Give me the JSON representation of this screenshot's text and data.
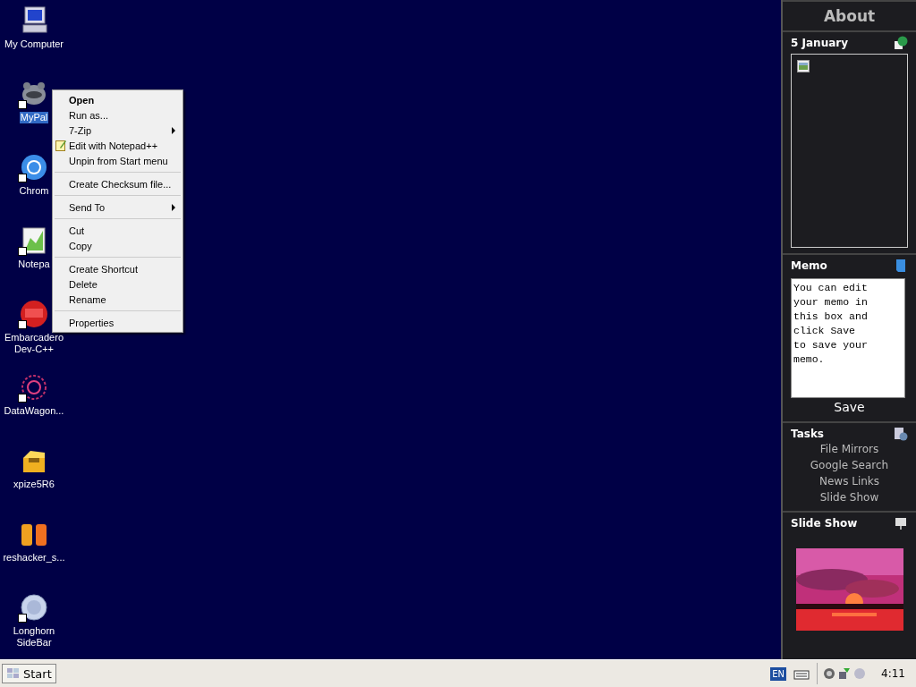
{
  "desktop": {
    "icons": [
      {
        "label": "My Computer",
        "kind": "computer",
        "shortcut": false,
        "selected": false
      },
      {
        "label": "MyPal",
        "kind": "critter",
        "shortcut": true,
        "selected": true
      },
      {
        "label": "Chrom",
        "kind": "ring",
        "shortcut": true,
        "selected": false
      },
      {
        "label": "Notepa",
        "kind": "notepad",
        "shortcut": true,
        "selected": false
      },
      {
        "label": "Embarcadero\nDev-C++",
        "kind": "badge",
        "shortcut": true,
        "selected": false
      },
      {
        "label": "DataWagon...",
        "kind": "star",
        "shortcut": true,
        "selected": false
      },
      {
        "label": "xpize5R6",
        "kind": "box",
        "shortcut": false,
        "selected": false
      },
      {
        "label": "reshacker_s...",
        "kind": "letters",
        "shortcut": false,
        "selected": false
      },
      {
        "label": "Longhorn\nSideBar",
        "kind": "disc",
        "shortcut": true,
        "selected": false
      }
    ]
  },
  "context_menu": {
    "items": [
      {
        "kind": "item",
        "label": "Open",
        "default": true,
        "submenu": false,
        "icon": false
      },
      {
        "kind": "item",
        "label": "Run as...",
        "default": false,
        "submenu": false,
        "icon": false
      },
      {
        "kind": "item",
        "label": "7-Zip",
        "default": false,
        "submenu": true,
        "icon": false
      },
      {
        "kind": "item",
        "label": "Edit with Notepad++",
        "default": false,
        "submenu": false,
        "icon": true
      },
      {
        "kind": "item",
        "label": "Unpin from Start menu",
        "default": false,
        "submenu": false,
        "icon": false
      },
      {
        "kind": "separator"
      },
      {
        "kind": "item",
        "label": "Create Checksum file...",
        "default": false,
        "submenu": false,
        "icon": false
      },
      {
        "kind": "separator"
      },
      {
        "kind": "item",
        "label": "Send To",
        "default": false,
        "submenu": true,
        "icon": false
      },
      {
        "kind": "separator"
      },
      {
        "kind": "item",
        "label": "Cut",
        "default": false,
        "submenu": false,
        "icon": false
      },
      {
        "kind": "item",
        "label": "Copy",
        "default": false,
        "submenu": false,
        "icon": false
      },
      {
        "kind": "separator"
      },
      {
        "kind": "item",
        "label": "Create Shortcut",
        "default": false,
        "submenu": false,
        "icon": false
      },
      {
        "kind": "item",
        "label": "Delete",
        "default": false,
        "submenu": false,
        "icon": false
      },
      {
        "kind": "item",
        "label": "Rename",
        "default": false,
        "submenu": false,
        "icon": false
      },
      {
        "kind": "separator"
      },
      {
        "kind": "item",
        "label": "Properties",
        "default": false,
        "submenu": false,
        "icon": false
      }
    ]
  },
  "sidebar": {
    "title": "About",
    "calendar": {
      "title": "5 January"
    },
    "memo": {
      "title": "Memo",
      "value": "You can edit\nyour memo in\nthis box and\nclick Save\nto save your\nmemo.",
      "button": "Save"
    },
    "tasks": {
      "title": "Tasks",
      "links": [
        "File Mirrors",
        "Google Search",
        "News Links",
        "Slide Show"
      ]
    },
    "slideshow": {
      "title": "Slide Show",
      "kind": "picture"
    }
  },
  "taskbar": {
    "start": "Start",
    "language": "EN",
    "clock": "4:11"
  }
}
